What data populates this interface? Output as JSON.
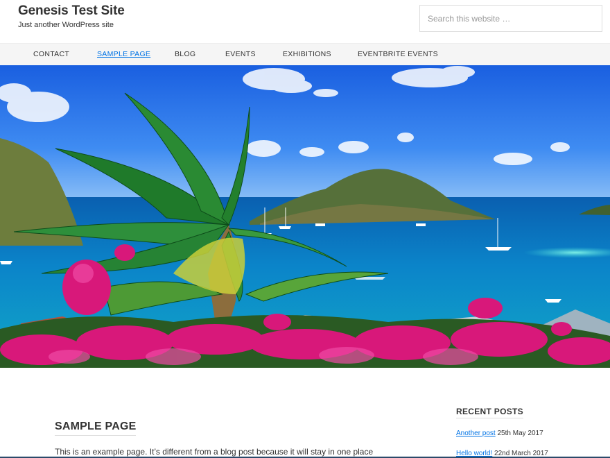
{
  "header": {
    "site_title": "Genesis Test Site",
    "site_description": "Just another WordPress site",
    "search_placeholder": "Search this website …"
  },
  "nav": {
    "items": [
      {
        "label": "CONTACT"
      },
      {
        "label": "SAMPLE PAGE",
        "active": true
      },
      {
        "label": "BLOG"
      },
      {
        "label": "EVENTS"
      },
      {
        "label": "EXHIBITIONS"
      },
      {
        "label": "EVENTBRITE EVENTS"
      }
    ]
  },
  "main": {
    "title": "SAMPLE PAGE",
    "text": "This is an example page. It’s different from a blog post because it will stay in one place"
  },
  "sidebar": {
    "widget_title": "RECENT POSTS",
    "posts": [
      {
        "title": "Another post",
        "date": "25th May 2017"
      },
      {
        "title": "Hello world!",
        "date": "22nd March 2017"
      }
    ]
  },
  "colors": {
    "link": "#0073e5",
    "nav_bg": "#f5f5f5",
    "text": "#333333"
  }
}
